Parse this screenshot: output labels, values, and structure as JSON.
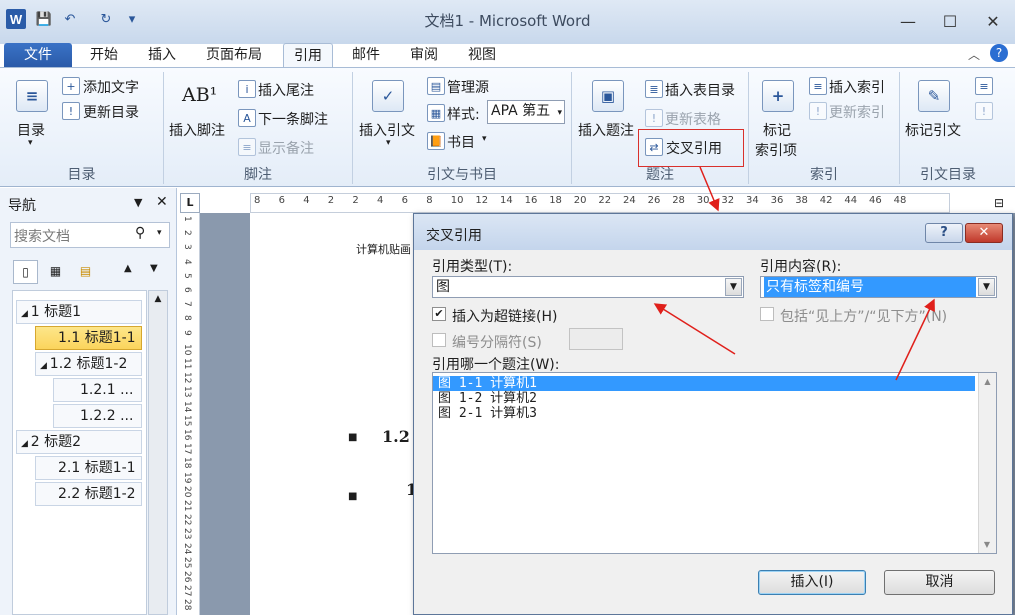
{
  "window": {
    "title": "文档1 - Microsoft Word",
    "minimize": "—",
    "maximize": "☐",
    "close": "✕"
  },
  "qat": {
    "word_icon": "W",
    "save": "💾",
    "undo": "↶",
    "redo": "↻",
    "more": "▾"
  },
  "tabs": {
    "file": "文件",
    "home": "开始",
    "insert": "插入",
    "layout": "页面布局",
    "references": "引用",
    "mailings": "邮件",
    "review": "审阅",
    "view": "视图"
  },
  "ribbon": {
    "toc": {
      "toc_btn": "目录",
      "add_text": "添加文字",
      "update_toc": "更新目录",
      "group": "目录"
    },
    "footnote": {
      "insert_footnote": "插入脚注",
      "insert_endnote": "插入尾注",
      "next_footnote": "下一条脚注",
      "show_notes": "显示备注",
      "group": "脚注",
      "ab_icon": "AB¹"
    },
    "citations": {
      "insert_citation": "插入引文",
      "manage_sources": "管理源",
      "style_label": "样式:",
      "style_value": "APA 第五",
      "bibliography": "书目",
      "group": "引文与书目"
    },
    "captions": {
      "insert_caption": "插入题注",
      "insert_table_figures": "插入表目录",
      "update_table": "更新表格",
      "cross_reference": "交叉引用",
      "group": "题注"
    },
    "index": {
      "mark_entry": "标记\n索引项",
      "mark_entry_1": "标记",
      "mark_entry_2": "索引项",
      "insert_index": "插入索引",
      "update_index": "更新索引",
      "group": "索引"
    },
    "toa": {
      "mark_citation": "标记引文",
      "group": "引文目录"
    }
  },
  "nav": {
    "title": "导航",
    "search_placeholder": "搜索文档",
    "items": [
      "1 标题1",
      "1.1 标题1-1",
      "1.2 标题1-2",
      "1.2.1 ...",
      "1.2.2 ...",
      "2 标题2",
      "2.1 标题1-1",
      "2.2 标题1-2"
    ]
  },
  "ruler": {
    "ticks": [
      "8",
      "6",
      "4",
      "2",
      "2",
      "4",
      "6",
      "8",
      "10",
      "12",
      "14",
      "16",
      "18",
      "20",
      "22",
      "24",
      "26",
      "28",
      "30",
      "32",
      "34",
      "36",
      "38",
      "42",
      "44",
      "46",
      "48"
    ],
    "vticks": [
      "1",
      "2",
      "3",
      "4",
      "5",
      "6",
      "7",
      "8",
      "9",
      "10",
      "11",
      "12",
      "13",
      "14",
      "15",
      "16",
      "17",
      "18",
      "19",
      "20",
      "21",
      "22",
      "23",
      "24",
      "25",
      "26",
      "27",
      "28"
    ]
  },
  "document": {
    "text1": "计算机贴画",
    "heading_partial": "1.2",
    "heading_partial2": "1"
  },
  "dialog": {
    "title": "交叉引用",
    "help": "?",
    "close": "✕",
    "ref_type_label": "引用类型(T):",
    "ref_type_value": "图",
    "ref_content_label": "引用内容(R):",
    "ref_content_value": "只有标签和编号",
    "insert_hyperlink": "插入为超链接(H)",
    "include_above_below": "包括“见上方”/“见下方”(N)",
    "separate_numbers": "编号分隔符(S)",
    "which_caption_label": "引用哪一个题注(W):",
    "captions": [
      "图 1-1 计算机1",
      "图 1-2 计算机2",
      "图 2-1 计算机3"
    ],
    "insert_btn": "插入(I)",
    "cancel_btn": "取消"
  },
  "colors": {
    "accent": "#2b579a",
    "arrow": "#e0201b",
    "selection": "#3399ff"
  }
}
